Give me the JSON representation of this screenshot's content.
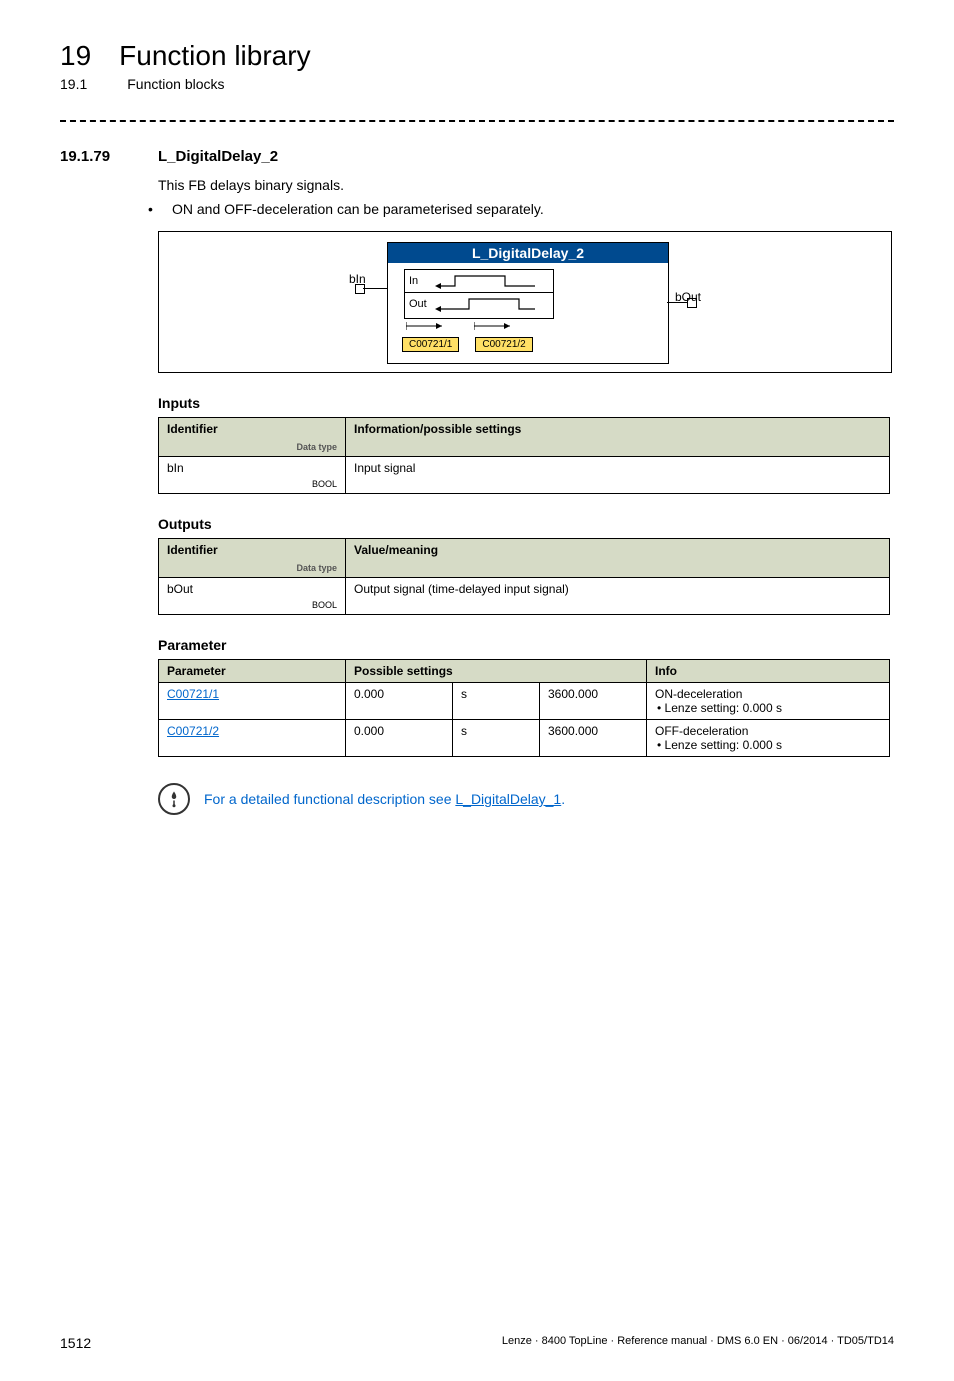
{
  "header": {
    "chapter_num": "19",
    "chapter_title": "Function library",
    "sub_num": "19.1",
    "sub_title": "Function blocks"
  },
  "section": {
    "num": "19.1.79",
    "title": "L_DigitalDelay_2",
    "desc": "This FB delays binary signals.",
    "bullet": "ON and OFF-deceleration can be parameterised separately."
  },
  "diagram": {
    "fb_title": "L_DigitalDelay_2",
    "in_label": "In",
    "out_label": "Out",
    "code1": "C00721/1",
    "code2": "C00721/2",
    "port_bin": "bIn",
    "port_bout": "bOut"
  },
  "inputs": {
    "heading": "Inputs",
    "col_identifier": "Identifier",
    "col_info": "Information/possible settings",
    "datatype_label": "Data type",
    "rows": [
      {
        "id": "bIn",
        "type": "BOOL",
        "info": "Input signal"
      }
    ]
  },
  "outputs": {
    "heading": "Outputs",
    "col_identifier": "Identifier",
    "col_info": "Value/meaning",
    "datatype_label": "Data type",
    "rows": [
      {
        "id": "bOut",
        "type": "BOOL",
        "info": "Output signal (time-delayed input signal)"
      }
    ]
  },
  "parameters": {
    "heading": "Parameter",
    "col_param": "Parameter",
    "col_settings": "Possible settings",
    "col_info": "Info",
    "rows": [
      {
        "param": "C00721/1",
        "min": "0.000",
        "unit": "s",
        "max": "3600.000",
        "info": "ON-deceleration",
        "sub": "Lenze setting: 0.000 s"
      },
      {
        "param": "C00721/2",
        "min": "0.000",
        "unit": "s",
        "max": "3600.000",
        "info": "OFF-deceleration",
        "sub": "Lenze setting: 0.000 s"
      }
    ]
  },
  "note": {
    "text_prefix": "For a detailed functional description see ",
    "link": "L_DigitalDelay_1",
    "suffix": "."
  },
  "footer": {
    "page": "1512",
    "doc": "Lenze · 8400 TopLine · Reference manual · DMS 6.0 EN · 06/2014 · TD05/TD14"
  }
}
